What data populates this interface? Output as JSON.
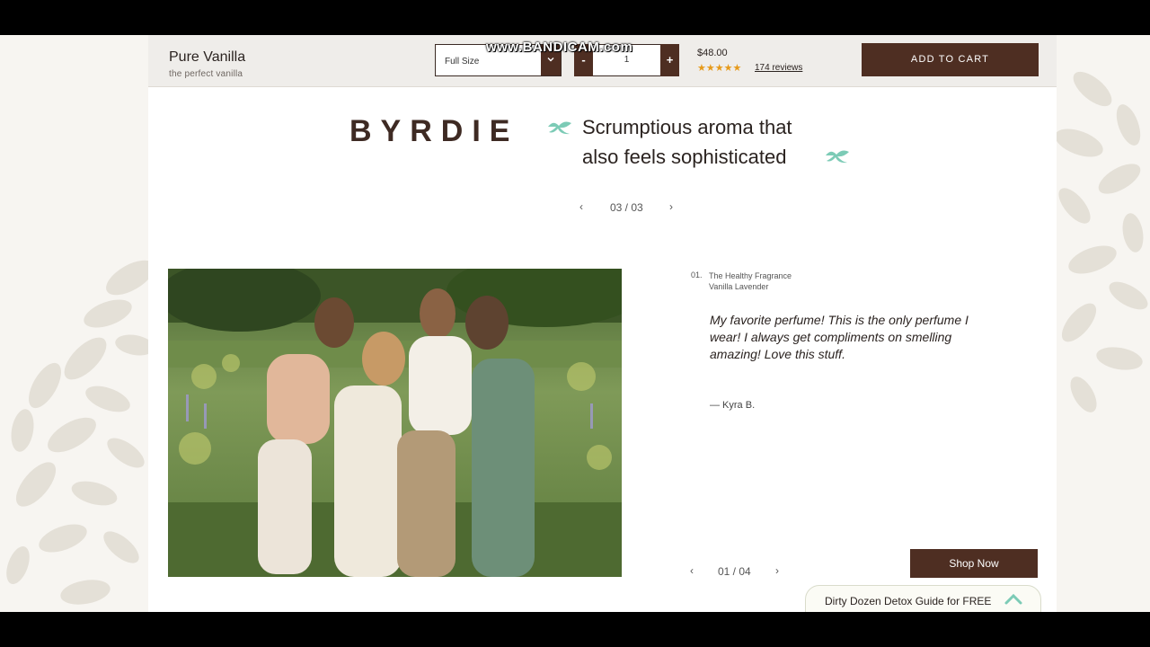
{
  "watermark": "www.BANDICAM.com",
  "product_bar": {
    "name": "Pure Vanilla",
    "subtitle": "the perfect vanilla",
    "size_select": {
      "value": "Full Size",
      "caret_icon": "chevron-down-icon"
    },
    "quantity": {
      "minus": "-",
      "value": "1",
      "plus": "+"
    },
    "price": "$48.00",
    "stars": "★★★★★",
    "reviews_label": "174 reviews",
    "add_to_cart": "ADD TO CART"
  },
  "press": {
    "logo": "BYRDIE",
    "quote_line1": "Scrumptious aroma that",
    "quote_line2": "also feels sophisticated",
    "pager": {
      "prev": "‹",
      "count": "03 / 03",
      "next": "›"
    }
  },
  "testimonial": {
    "number": "01.",
    "product_line1": "The Healthy Fragrance",
    "product_line2": "Vanilla Lavender",
    "quote": "My favorite perfume! This is the only perfume I wear! I always get compliments on smelling amazing! Love this stuff.",
    "author": "— Kyra B.",
    "pager": {
      "prev": "‹",
      "count": "01 / 04",
      "next": "›"
    },
    "shop_now": "Shop Now"
  },
  "guide": {
    "label": "Dirty Dozen Detox Guide for FREE",
    "icon": "chevron-up-icon"
  },
  "colors": {
    "brand_brown": "#4e2e22",
    "accent_mint": "#7ccbb6",
    "star_orange": "#e69a1b"
  }
}
